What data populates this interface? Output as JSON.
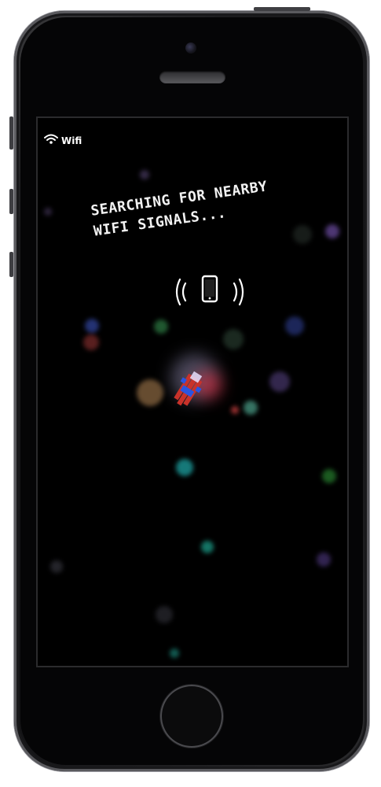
{
  "status_bar": {
    "network_icon": "wifi-icon",
    "network_label": "Wifi"
  },
  "message": {
    "text": "SEARCHING FOR NEARBY\nWIFI SIGNALS..."
  },
  "signal_graphic": {
    "icon": "phone-signal-icon"
  },
  "colors": {
    "background": "#000000",
    "text": "#ffffff",
    "character_red": "#c8322a",
    "character_blue": "#2a55e0"
  }
}
